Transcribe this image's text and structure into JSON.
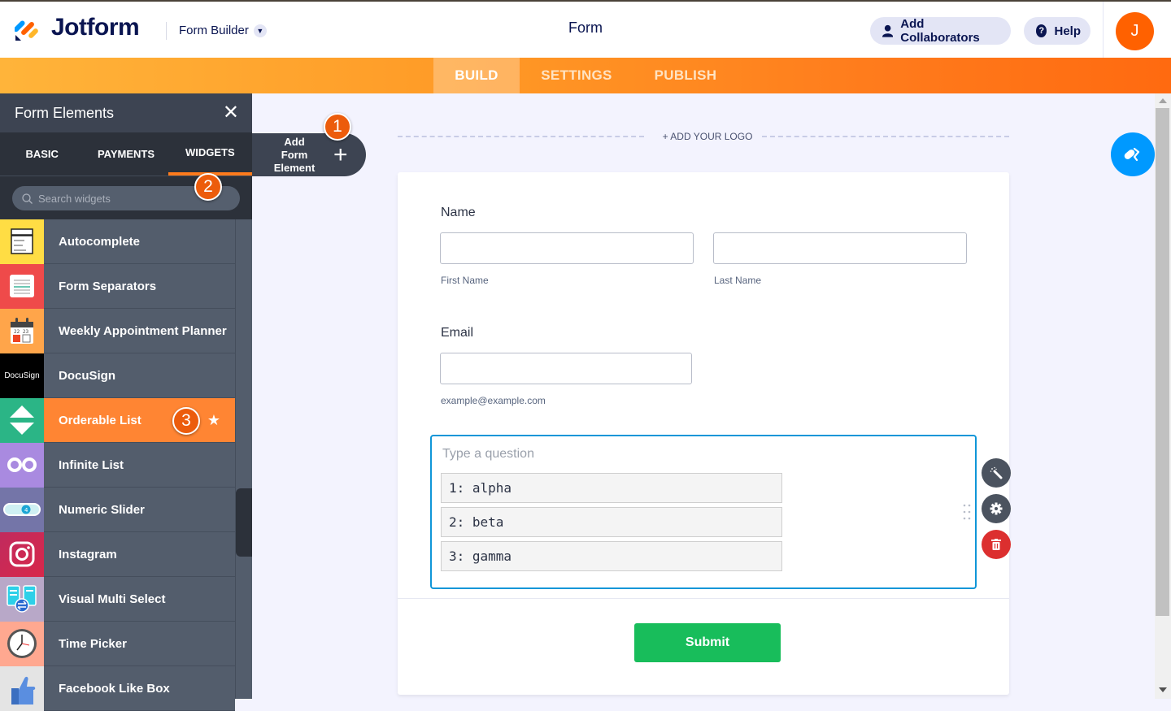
{
  "header": {
    "brand": "Jotform",
    "mode_label": "Form Builder",
    "page_title": "Form",
    "collaborators_label": "Add Collaborators",
    "help_label": "Help",
    "avatar_initial": "J",
    "help_glyph": "?"
  },
  "nav": {
    "tabs": [
      {
        "label": "BUILD",
        "active": true
      },
      {
        "label": "SETTINGS",
        "active": false
      },
      {
        "label": "PUBLISH",
        "active": false
      }
    ]
  },
  "sidebar": {
    "title": "Form Elements",
    "close_glyph": "✕",
    "tabs": [
      {
        "label": "BASIC",
        "active": false
      },
      {
        "label": "PAYMENTS",
        "active": false
      },
      {
        "label": "WIDGETS",
        "active": true
      }
    ],
    "search_placeholder": "Search widgets",
    "widgets": [
      {
        "label": "Autocomplete",
        "icon": "autocomplete-icon",
        "color": "#ffdd44"
      },
      {
        "label": "Form Separators",
        "icon": "form-separator-icon",
        "color": "#ef4a4a"
      },
      {
        "label": "Weekly Appointment Planner",
        "icon": "calendar-icon",
        "color": "#ffa54a"
      },
      {
        "label": "DocuSign",
        "icon": "docusign-icon",
        "color": "#000000",
        "icon_text": "DocuSign"
      },
      {
        "label": "Orderable List",
        "icon": "orderable-list-icon",
        "color": "#2bb586",
        "active": true,
        "favorite_glyph": "★"
      },
      {
        "label": "Infinite List",
        "icon": "infinity-icon",
        "color": "#a98ae0"
      },
      {
        "label": "Numeric Slider",
        "icon": "slider-icon",
        "color": "#7475a8",
        "icon_text": "4"
      },
      {
        "label": "Instagram",
        "icon": "instagram-icon",
        "color": "#c02a5e"
      },
      {
        "label": "Visual Multi Select",
        "icon": "multi-select-icon",
        "color": "#b8a8c8"
      },
      {
        "label": "Time Picker",
        "icon": "clock-icon",
        "color": "#ffa890"
      },
      {
        "label": "Facebook Like Box",
        "icon": "thumbs-up-icon",
        "color": "#e4e4e4"
      }
    ]
  },
  "add_element": {
    "label_line1": "Add Form",
    "label_line2": "Element",
    "plus_glyph": "+"
  },
  "step_badges": [
    "1",
    "2",
    "3"
  ],
  "canvas": {
    "add_logo_label": "+ ADD YOUR LOGO",
    "fields": {
      "name_label": "Name",
      "first_name_sublabel": "First Name",
      "last_name_sublabel": "Last Name",
      "first_name_value": "",
      "last_name_value": "",
      "email_label": "Email",
      "email_value": "",
      "email_sublabel": "example@example.com"
    },
    "orderable": {
      "question_placeholder": "Type a question",
      "items": [
        "1: alpha",
        "2: beta",
        "3: gamma"
      ]
    },
    "submit_label": "Submit"
  },
  "colors": {
    "brand_orange": "#ff6100",
    "accent_blue": "#0f96d8",
    "submit_green": "#18bd5b",
    "delete_red": "#dc2f2f",
    "sidebar_bg": "#3d4452"
  }
}
